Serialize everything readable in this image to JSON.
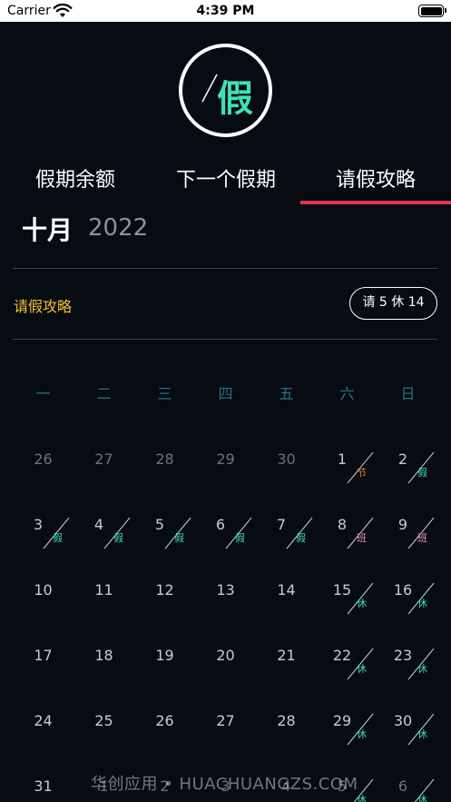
{
  "status_bar": {
    "carrier": "Carrier",
    "time": "4:39 PM",
    "wifi_icon": "wifi-icon",
    "battery_icon": "battery-icon"
  },
  "logo": {
    "text": "假"
  },
  "tabs": [
    {
      "label": "假期余额"
    },
    {
      "label": "下一个假期"
    },
    {
      "label": "请假攻略",
      "active": true
    }
  ],
  "header": {
    "month": "十月",
    "year": "2022"
  },
  "strategy": {
    "label": "请假攻略",
    "badge": "请 5 休 14"
  },
  "weekdays": [
    "一",
    "二",
    "三",
    "四",
    "五",
    "六",
    "日"
  ],
  "calendar": [
    [
      {
        "d": "26",
        "other": true
      },
      {
        "d": "27",
        "other": true
      },
      {
        "d": "28",
        "other": true
      },
      {
        "d": "29",
        "other": true
      },
      {
        "d": "30",
        "other": true
      },
      {
        "d": "1",
        "tag": "节",
        "kind": "jie"
      },
      {
        "d": "2",
        "tag": "假",
        "kind": "jia"
      }
    ],
    [
      {
        "d": "3",
        "tag": "假",
        "kind": "jia"
      },
      {
        "d": "4",
        "tag": "假",
        "kind": "jia"
      },
      {
        "d": "5",
        "tag": "假",
        "kind": "jia"
      },
      {
        "d": "6",
        "tag": "假",
        "kind": "jia"
      },
      {
        "d": "7",
        "tag": "假",
        "kind": "jia"
      },
      {
        "d": "8",
        "tag": "班",
        "kind": "ban"
      },
      {
        "d": "9",
        "tag": "班",
        "kind": "ban"
      }
    ],
    [
      {
        "d": "10"
      },
      {
        "d": "11"
      },
      {
        "d": "12"
      },
      {
        "d": "13"
      },
      {
        "d": "14"
      },
      {
        "d": "15",
        "tag": "休",
        "kind": "xiu"
      },
      {
        "d": "16",
        "tag": "休",
        "kind": "xiu"
      }
    ],
    [
      {
        "d": "17"
      },
      {
        "d": "18"
      },
      {
        "d": "19"
      },
      {
        "d": "20"
      },
      {
        "d": "21"
      },
      {
        "d": "22",
        "tag": "休",
        "kind": "xiu"
      },
      {
        "d": "23",
        "tag": "休",
        "kind": "xiu"
      }
    ],
    [
      {
        "d": "24"
      },
      {
        "d": "25"
      },
      {
        "d": "26"
      },
      {
        "d": "27"
      },
      {
        "d": "28"
      },
      {
        "d": "29",
        "tag": "休",
        "kind": "xiu"
      },
      {
        "d": "30",
        "tag": "休",
        "kind": "xiu"
      }
    ],
    [
      {
        "d": "31"
      },
      {
        "d": "1",
        "other": true
      },
      {
        "d": "2",
        "other": true
      },
      {
        "d": "3",
        "other": true
      },
      {
        "d": "4",
        "other": true
      },
      {
        "d": "5",
        "tag": "休",
        "kind": "xiu",
        "other": true
      },
      {
        "d": "6",
        "tag": "休",
        "kind": "xiu",
        "other": true
      }
    ]
  ],
  "watermark": "华创应用 • HUACHUANGZS.COM",
  "colors": {
    "background": "#060c12",
    "accent_tab": "#e0364a",
    "jia": "#3fe0b4",
    "jie": "#f07a2b",
    "ban": "#f290c9",
    "strategy": "#f1c232",
    "weekday": "#2b6f85"
  }
}
